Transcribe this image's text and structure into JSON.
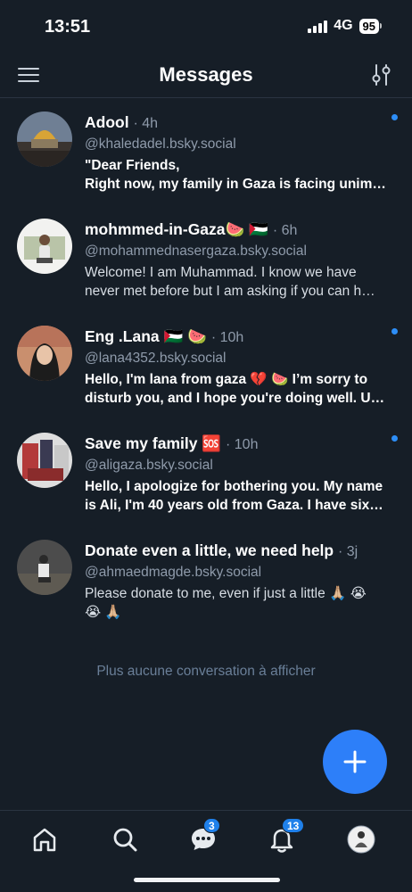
{
  "status_bar": {
    "time": "13:51",
    "network": "4G",
    "battery": "95"
  },
  "header": {
    "title": "Messages",
    "menu_icon": "hamburger-icon",
    "settings_icon": "sliders-icon"
  },
  "conversations": [
    {
      "name": "Adool",
      "time": "· 4h",
      "handle": "@khaledadel.bsky.social",
      "preview_lines": [
        "\"Dear Friends,",
        "Right now, my family in Gaza is facing unim…"
      ],
      "unread": true
    },
    {
      "name": "mohmmed-in-Gaza🍉 🇵🇸",
      "time": "· 6h",
      "handle": "@mohammednasergaza.bsky.social",
      "preview_lines": [
        "Welcome! I am Muhammad. I know we have",
        "never met before but I am asking if you can h…"
      ],
      "unread": false
    },
    {
      "name": "Eng .Lana 🇵🇸 🍉",
      "time": "· 10h",
      "handle": "@lana4352.bsky.social",
      "preview_lines": [
        "Hello, I'm lana from gaza 💔 🍉 I’m sorry to",
        "disturb you, and I hope you're doing well. U…"
      ],
      "unread": true
    },
    {
      "name": "Save my family 🆘",
      "time": "· 10h",
      "handle": "@aligaza.bsky.social",
      "preview_lines": [
        "Hello, I apologize for bothering you. My name",
        "is Ali, I'm 40 years old from Gaza. I have six…"
      ],
      "unread": true
    },
    {
      "name": "Donate even a little, we need help",
      "time": "· 3j",
      "handle": "@ahmaedmagde.bsky.social",
      "preview_lines": [
        "Please donate to me, even if just a little 🙏🏼 😭",
        "😭 🙏🏼"
      ],
      "unread": false
    }
  ],
  "empty_note": "Plus aucune conversation à afficher",
  "bottom_nav": {
    "items": [
      {
        "icon": "home-icon",
        "badge": ""
      },
      {
        "icon": "search-icon",
        "badge": ""
      },
      {
        "icon": "chat-icon",
        "badge": "3"
      },
      {
        "icon": "bell-icon",
        "badge": "13"
      },
      {
        "icon": "avatar",
        "badge": ""
      }
    ]
  },
  "colors": {
    "background": "#161e27",
    "accent": "#2d7ff9",
    "badge": "#1f80ea",
    "muted": "#8f9bab"
  }
}
